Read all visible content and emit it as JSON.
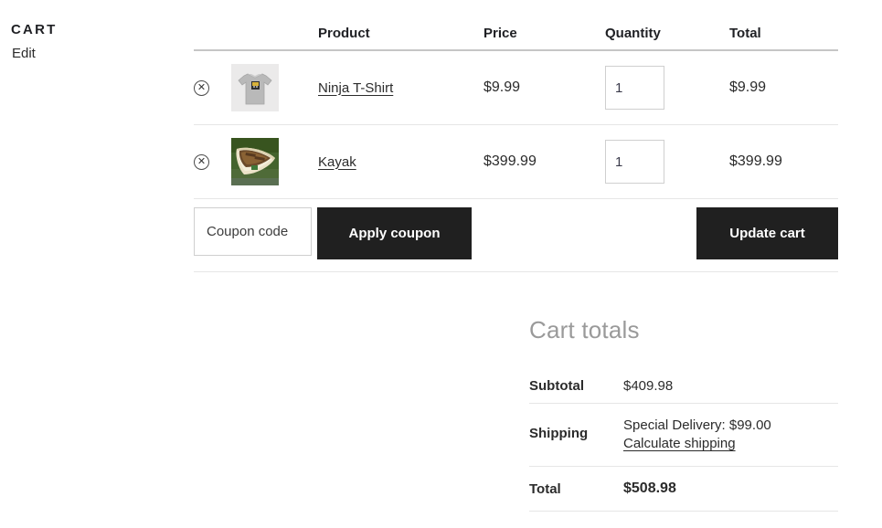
{
  "sidebar": {
    "title": "CART",
    "edit_label": "Edit"
  },
  "cart_table": {
    "headers": {
      "remove": "",
      "thumbnail": "",
      "product": "Product",
      "price": "Price",
      "quantity": "Quantity",
      "total": "Total"
    },
    "items": [
      {
        "remove_icon": "circle-x-icon",
        "thumbnail": "gray-t-shirt-thumbnail",
        "name": "Ninja T-Shirt",
        "price": "$9.99",
        "quantity": "1",
        "total": "$9.99"
      },
      {
        "remove_icon": "circle-x-icon",
        "thumbnail": "kayak-canoe-thumbnail",
        "name": "Kayak",
        "price": "$399.99",
        "quantity": "1",
        "total": "$399.99"
      }
    ]
  },
  "actions": {
    "coupon_placeholder": "Coupon code",
    "coupon_value": "",
    "apply_coupon_label": "Apply coupon",
    "update_cart_label": "Update cart"
  },
  "cart_totals": {
    "title": "Cart totals",
    "subtotal_label": "Subtotal",
    "subtotal_value": "$409.98",
    "shipping_label": "Shipping",
    "shipping_method": "Special Delivery: $99.00",
    "calculate_shipping_label": "Calculate shipping",
    "total_label": "Total",
    "total_value": "$508.98"
  },
  "colors": {
    "button_dark": "#202020",
    "text": "#2b2b2b",
    "muted_heading": "#9a9a9a",
    "border": "#e6e6e6"
  }
}
